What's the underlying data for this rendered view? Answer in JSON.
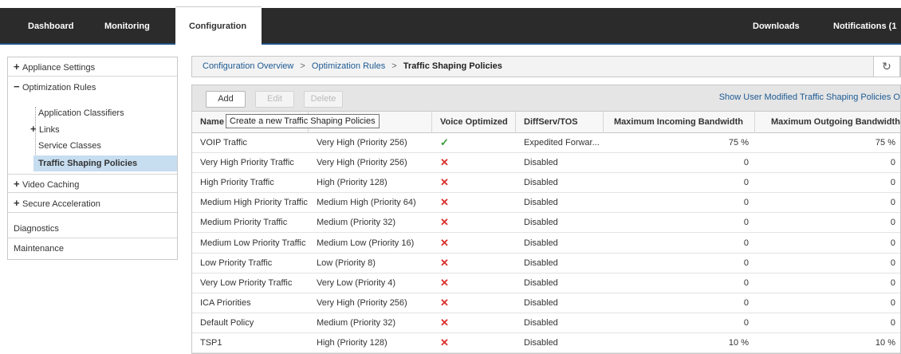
{
  "topnav": {
    "tabs": [
      "Dashboard",
      "Monitoring",
      "Configuration"
    ],
    "right": [
      "Downloads",
      "Notifications (1"
    ]
  },
  "sidebar": {
    "items": [
      {
        "sign": "+",
        "label": "Appliance Settings"
      },
      {
        "sign": "−",
        "label": "Optimization Rules"
      },
      {
        "label": "Application Classifiers"
      },
      {
        "sign": "+",
        "label": "Links"
      },
      {
        "label": "Service Classes"
      },
      {
        "label": "Traffic Shaping Policies"
      },
      {
        "sign": "+",
        "label": "Video Caching"
      },
      {
        "sign": "+",
        "label": "Secure Acceleration"
      },
      {
        "label": "Diagnostics"
      },
      {
        "label": "Maintenance"
      }
    ]
  },
  "breadcrumb": {
    "items": [
      "Configuration Overview",
      "Optimization Rules",
      "Traffic Shaping Policies"
    ],
    "separator": ">"
  },
  "toolbar": {
    "add": "Add",
    "edit": "Edit",
    "delete": "Delete",
    "show_link": "Show User Modified Traffic Shaping Policies Only"
  },
  "tooltip": "Create a new Traffic Shaping Policies",
  "table": {
    "columns": [
      "Name",
      "",
      "Voice Optimized",
      "DiffServ/TOS",
      "Maximum Incoming Bandwidth",
      "Maximum Outgoing Bandwidth"
    ],
    "rows": [
      [
        "VOIP Traffic",
        "Very High (Priority 256)",
        "check",
        "Expedited Forwar...",
        "75 %",
        "75 %"
      ],
      [
        "Very High Priority Traffic",
        "Very High (Priority 256)",
        "cross",
        "Disabled",
        "0",
        "0"
      ],
      [
        "High Priority Traffic",
        "High (Priority 128)",
        "cross",
        "Disabled",
        "0",
        "0"
      ],
      [
        "Medium High Priority Traffic",
        "Medium High (Priority 64)",
        "cross",
        "Disabled",
        "0",
        "0"
      ],
      [
        "Medium Priority Traffic",
        "Medium (Priority 32)",
        "cross",
        "Disabled",
        "0",
        "0"
      ],
      [
        "Medium Low Priority Traffic",
        "Medium Low (Priority 16)",
        "cross",
        "Disabled",
        "0",
        "0"
      ],
      [
        "Low Priority Traffic",
        "Low (Priority 8)",
        "cross",
        "Disabled",
        "0",
        "0"
      ],
      [
        "Very Low Priority Traffic",
        "Very Low (Priority 4)",
        "cross",
        "Disabled",
        "0",
        "0"
      ],
      [
        "ICA Priorities",
        "Very High (Priority 256)",
        "cross",
        "Disabled",
        "0",
        "0"
      ],
      [
        "Default Policy",
        "Medium (Priority 32)",
        "cross",
        "Disabled",
        "0",
        "0"
      ],
      [
        "TSP1",
        "High (Priority 128)",
        "cross",
        "Disabled",
        "10 %",
        "10 %"
      ]
    ]
  },
  "icons": {
    "check": "✓",
    "cross": "✕",
    "refresh": "↻"
  },
  "colors": {
    "nav_bg": "#2b2b2b",
    "link": "#1d5a93",
    "selected_bg": "#c7ddf0",
    "check": "#3a9a3a",
    "cross": "#d9302c"
  }
}
